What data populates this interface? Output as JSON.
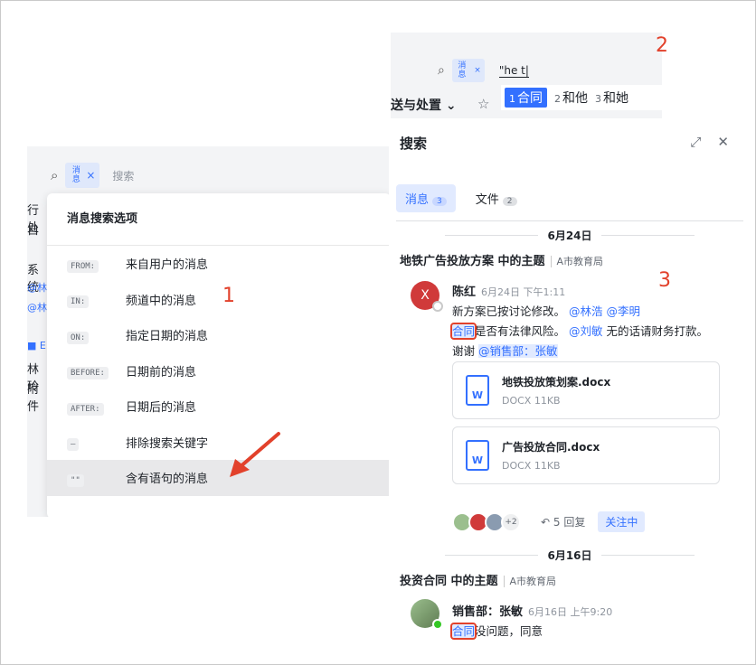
{
  "panel1": {
    "tag_label": "消息",
    "search_placeholder": "搜索",
    "left_fragments": [
      "行处",
      "自",
      "",
      "系统",
      "@林",
      "@林",
      "",
      "■ E",
      "林玲",
      "附件"
    ],
    "dropdown_title": "消息搜索选项",
    "options": [
      {
        "keyword": "FROM:",
        "label": "来自用户的消息"
      },
      {
        "keyword": "IN:",
        "label": "频道中的消息"
      },
      {
        "keyword": "ON:",
        "label": "指定日期的消息"
      },
      {
        "keyword": "BEFORE:",
        "label": "日期前的消息"
      },
      {
        "keyword": "AFTER:",
        "label": "日期后的消息"
      },
      {
        "keyword": "—",
        "label": "排除搜索关键字"
      },
      {
        "keyword": "\"\"",
        "label": "含有语句的消息"
      }
    ],
    "callout_number": "1"
  },
  "panel2": {
    "tag_label": "消息",
    "input_value": "\"he t|",
    "candidates": [
      {
        "n": "1",
        "text": "合同"
      },
      {
        "n": "2",
        "text": "和他"
      },
      {
        "n": "3",
        "text": "和她"
      }
    ],
    "breadcrumb": "送与处置 ⌄",
    "callout_number": "2"
  },
  "panel3": {
    "title": "搜索",
    "tabs": [
      {
        "label": "消息",
        "count": "3"
      },
      {
        "label": "文件",
        "count": "2"
      }
    ],
    "callout_number": "3",
    "group1": {
      "date": "6月24日",
      "topic": "地铁广告投放方案 中的主题",
      "org": "A市教育局",
      "avatar_initial": "X",
      "sender": "陈红",
      "time": "6月24日 下午1:11",
      "line1_text": "新方案已按讨论修改。",
      "line1_mentions": [
        "@林浩",
        "@李明"
      ],
      "line2_hit": "合同",
      "line2_text": "是否有法律风险。",
      "line2_mention": "@刘敏",
      "line2_tail": "无的话请财务打款。",
      "line3_text": "谢谢",
      "line3_mention": "@销售部：张敏",
      "files": [
        {
          "name": "地铁投放策划案.docx",
          "meta": "DOCX 11KB"
        },
        {
          "name": "广告投放合同.docx",
          "meta": "DOCX 11KB"
        }
      ],
      "extra_count": "+2",
      "replies": "5 回复",
      "follow": "关注中"
    },
    "group2": {
      "date": "6月16日",
      "topic": "投资合同 中的主题",
      "org": "A市教育局",
      "sender": "销售部：张敏",
      "time": "6月16日 上午9:20",
      "hit": "合同",
      "text": "没问题，同意"
    }
  }
}
